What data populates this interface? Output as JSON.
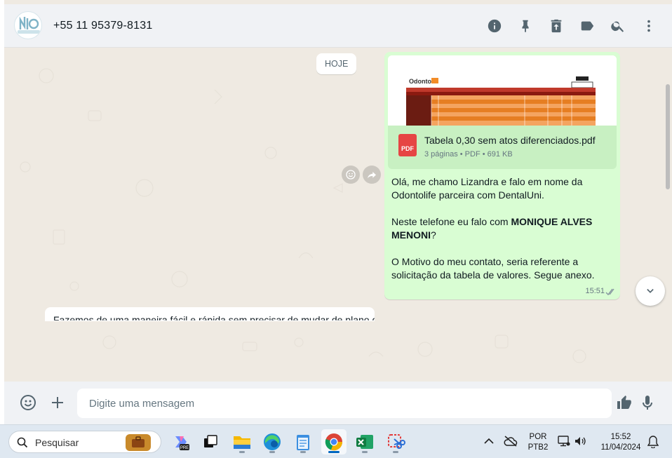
{
  "header": {
    "contact_name": "+55 11 95379-8131",
    "icons": [
      "info-icon",
      "pin-icon",
      "delete-icon",
      "label-icon",
      "search-icon",
      "menu-icon"
    ]
  },
  "chat": {
    "date_label": "HOJE",
    "outgoing": {
      "document": {
        "name": "Tabela 0,30 sem atos diferenciados.pdf",
        "meta": "3 páginas • PDF • 691 KB",
        "icon_label": "PDF"
      },
      "paragraphs": [
        "Olá, me chamo Lizandra e falo em nome da Odontolife parceira com DentalUni.",
        "Neste telefone eu falo com |MONIQUE ALVES MENONI|?",
        "O Motivo do meu contato, seria referente a solicitação da tabela de valores. Segue anexo."
      ],
      "para1": "Olá, me chamo Lizandra e falo em nome da Odontolife parceira com DentalUni.",
      "para2_pre": "Neste telefone eu falo com ",
      "para2_bold": "MONIQUE ALVES MENONI",
      "para2_post": "?",
      "para3": "O Motivo do meu contato, seria referente a solicitação da tabela de valores. Segue anexo.",
      "time": "15:51",
      "status": "read"
    },
    "incoming_partial_text": "Fazemos de uma maneira fácil e rápida sem precisar de mudar de plano dentro"
  },
  "composer": {
    "placeholder": "Digite uma mensagem"
  },
  "taskbar": {
    "search_label": "Pesquisar",
    "language_line1": "POR",
    "language_line2": "PTB2",
    "clock_time": "15:52",
    "clock_date": "11/04/2024"
  },
  "colors": {
    "outgoing_bubble": "#d9fdd3",
    "doc_row": "#c8f0c2",
    "pdf_icon": "#e64544",
    "chat_background": "#efeae2",
    "header_background": "#f0f2f5"
  }
}
